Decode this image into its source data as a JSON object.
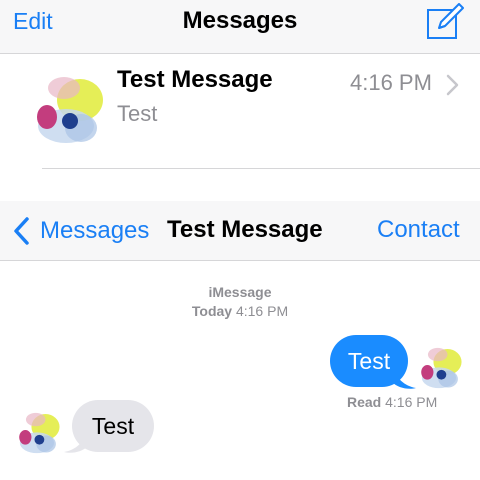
{
  "list": {
    "edit_label": "Edit",
    "title": "Messages",
    "compose_icon": "compose-icon",
    "conversation": {
      "name": "Test Message",
      "preview": "Test",
      "time": "4:16 PM"
    }
  },
  "conversation": {
    "back_label": "Messages",
    "title": "Test Message",
    "contact_label": "Contact",
    "service_label": "iMessage",
    "day_label": "Today",
    "day_time": "4:16 PM",
    "messages": [
      {
        "direction": "outgoing",
        "text": "Test"
      },
      {
        "direction": "incoming",
        "text": "Test"
      }
    ],
    "receipt_label": "Read",
    "receipt_time": "4:16 PM"
  },
  "colors": {
    "accent": "#1a7ff5",
    "outgoing_bubble": "#1a8cff",
    "incoming_bubble": "#e5e5ea",
    "secondary_text": "#8e8e93"
  }
}
